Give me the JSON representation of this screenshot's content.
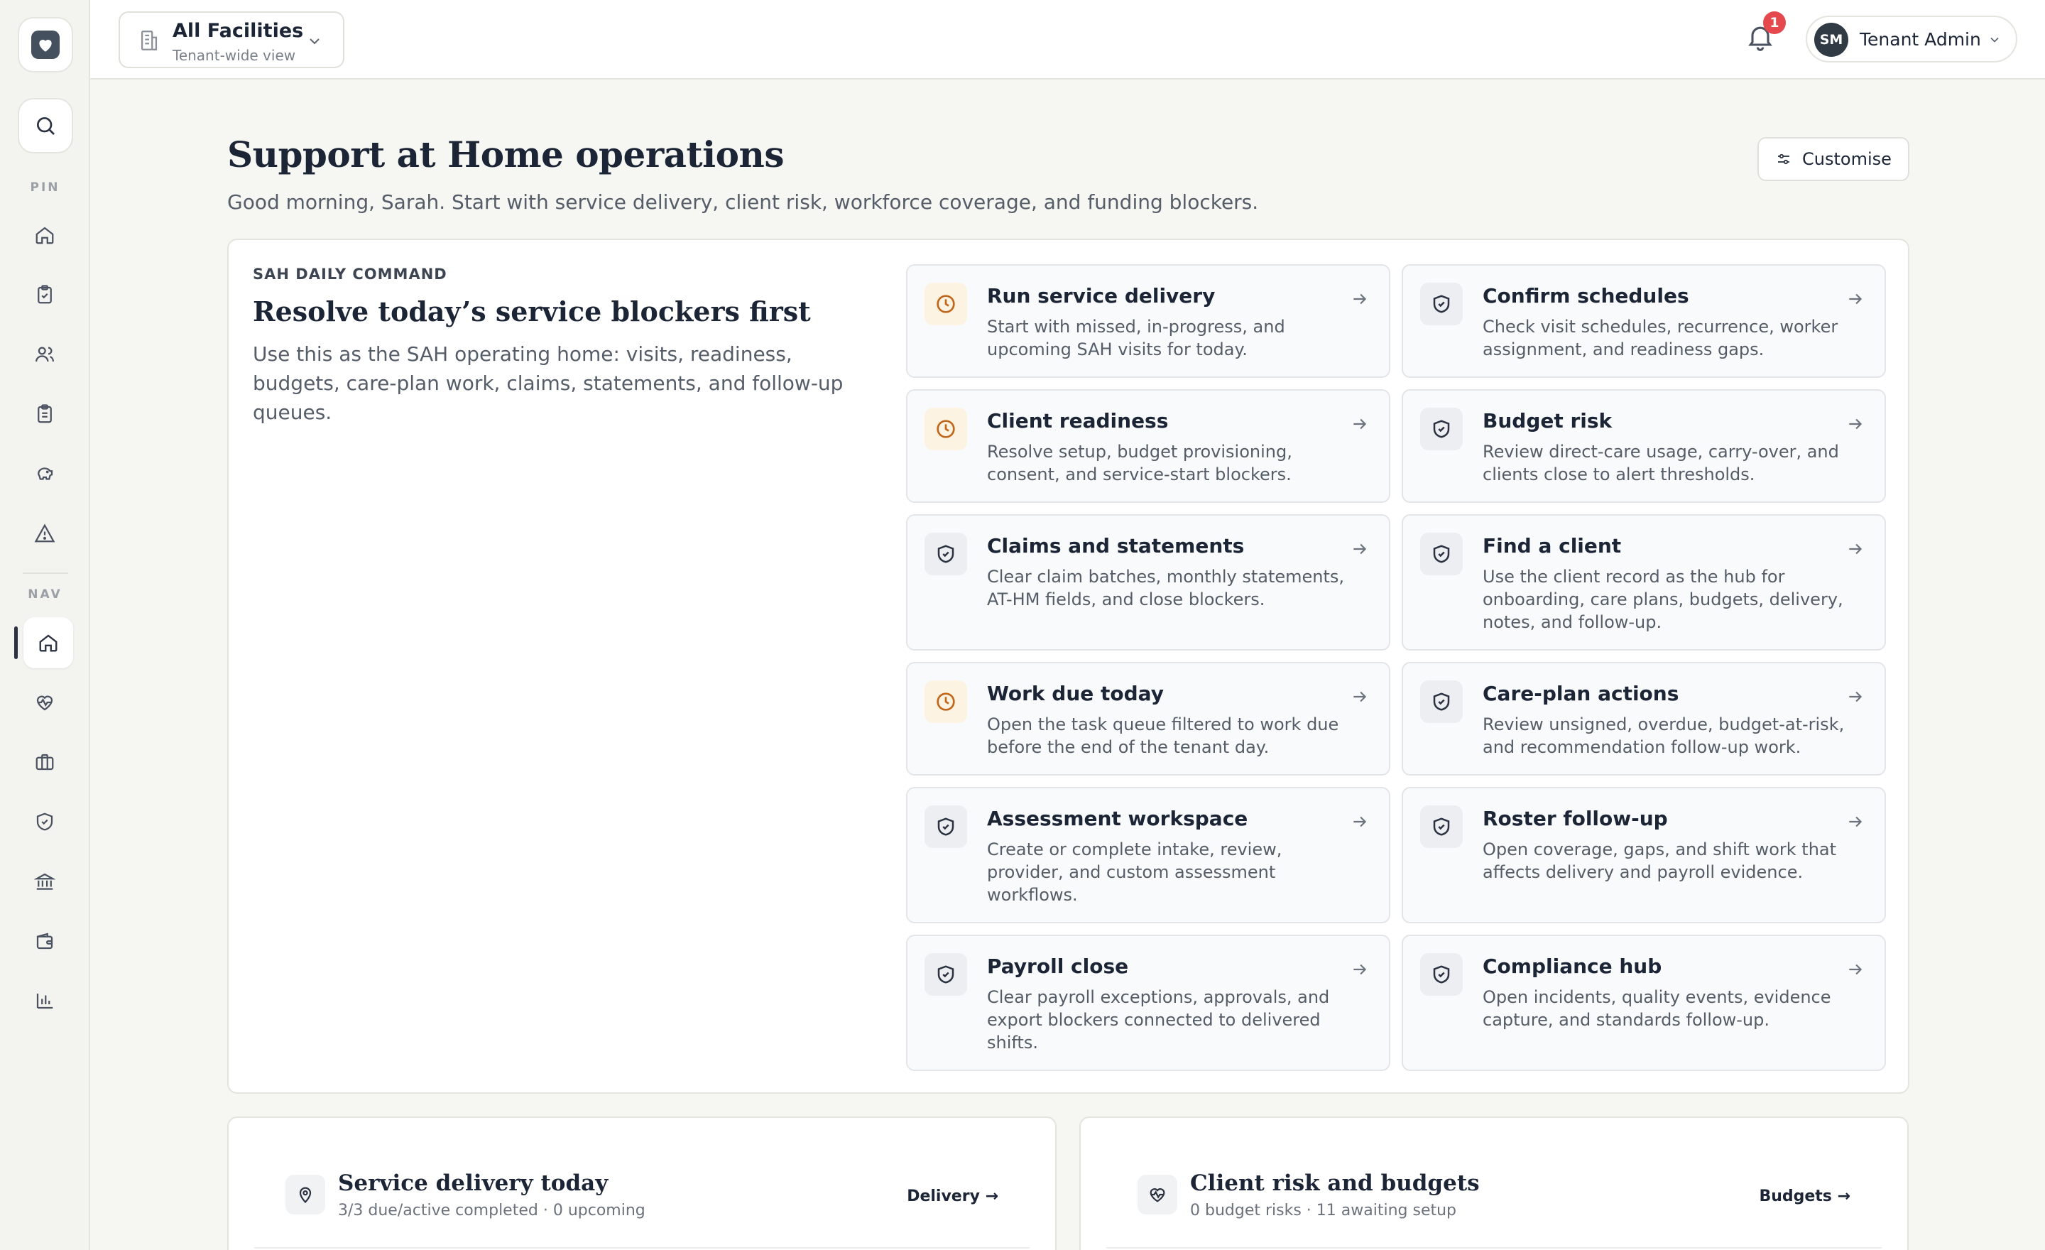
{
  "header": {
    "facility_name": "All Facilities",
    "facility_sub": "Tenant-wide view",
    "notification_count": "1",
    "user_initials": "SM",
    "user_name": "Tenant Admin"
  },
  "sidebar": {
    "pin_label": "PIN",
    "nav_label": "NAV",
    "pin_items": [
      "home-icon",
      "clipboard-check-icon",
      "users-icon",
      "clipboard-list-icon",
      "piggy-bank-icon",
      "alert-triangle-icon"
    ],
    "nav_items": [
      "home-icon",
      "heart-pulse-icon",
      "briefcase-icon",
      "shield-check-icon",
      "bank-icon",
      "wallet-icon",
      "bar-chart-icon"
    ],
    "active_nav": "home-icon"
  },
  "page": {
    "title": "Support at Home operations",
    "subtitle": "Good morning, Sarah. Start with service delivery, client risk, workforce coverage, and funding blockers.",
    "customise_label": "Customise"
  },
  "command": {
    "eyebrow": "SAH DAILY COMMAND",
    "title": "Resolve today’s service blockers first",
    "description": "Use this as the SAH operating home: visits, readiness, budgets, care-plan work, claims, statements, and follow-up queues.",
    "cards": [
      {
        "title": "Run service delivery",
        "desc": "Start with missed, in-progress, and upcoming SAH visits for today.",
        "icon": "clock-icon"
      },
      {
        "title": "Confirm schedules",
        "desc": "Check visit schedules, recurrence, worker assignment, and readiness gaps.",
        "icon": "shield-check-icon"
      },
      {
        "title": "Client readiness",
        "desc": "Resolve setup, budget provisioning, consent, and service-start blockers.",
        "icon": "clock-icon"
      },
      {
        "title": "Budget risk",
        "desc": "Review direct-care usage, carry-over, and clients close to alert thresholds.",
        "icon": "shield-check-icon"
      },
      {
        "title": "Claims and statements",
        "desc": "Clear claim batches, monthly statements, AT-HM fields, and close blockers.",
        "icon": "shield-check-icon"
      },
      {
        "title": "Find a client",
        "desc": "Use the client record as the hub for onboarding, care plans, budgets, delivery, notes, and follow-up.",
        "icon": "shield-check-icon"
      },
      {
        "title": "Work due today",
        "desc": "Open the task queue filtered to work due before the end of the tenant day.",
        "icon": "clock-icon"
      },
      {
        "title": "Care-plan actions",
        "desc": "Review unsigned, overdue, budget-at-risk, and recommendation follow-up work.",
        "icon": "shield-check-icon"
      },
      {
        "title": "Assessment workspace",
        "desc": "Create or complete intake, review, provider, and custom assessment workflows.",
        "icon": "shield-check-icon"
      },
      {
        "title": "Roster follow-up",
        "desc": "Open coverage, gaps, and shift work that affects delivery and payroll evidence.",
        "icon": "shield-check-icon"
      },
      {
        "title": "Payroll close",
        "desc": "Clear payroll exceptions, approvals, and export blockers connected to delivered shifts.",
        "icon": "shield-check-icon"
      },
      {
        "title": "Compliance hub",
        "desc": "Open incidents, quality events, evidence capture, and standards follow-up.",
        "icon": "shield-check-icon"
      }
    ]
  },
  "bottom": [
    {
      "title": "Service delivery today",
      "sub": "3/3 due/active completed · 0 upcoming",
      "link": "Delivery →",
      "icon": "map-pin-icon"
    },
    {
      "title": "Client risk and budgets",
      "sub": "0 budget risks · 11 awaiting setup",
      "link": "Budgets →",
      "icon": "heart-pulse-icon"
    }
  ],
  "colors": {
    "accent_dark": "#2a3140",
    "warn_icon": "#c2661a",
    "badge": "#e5484d"
  }
}
